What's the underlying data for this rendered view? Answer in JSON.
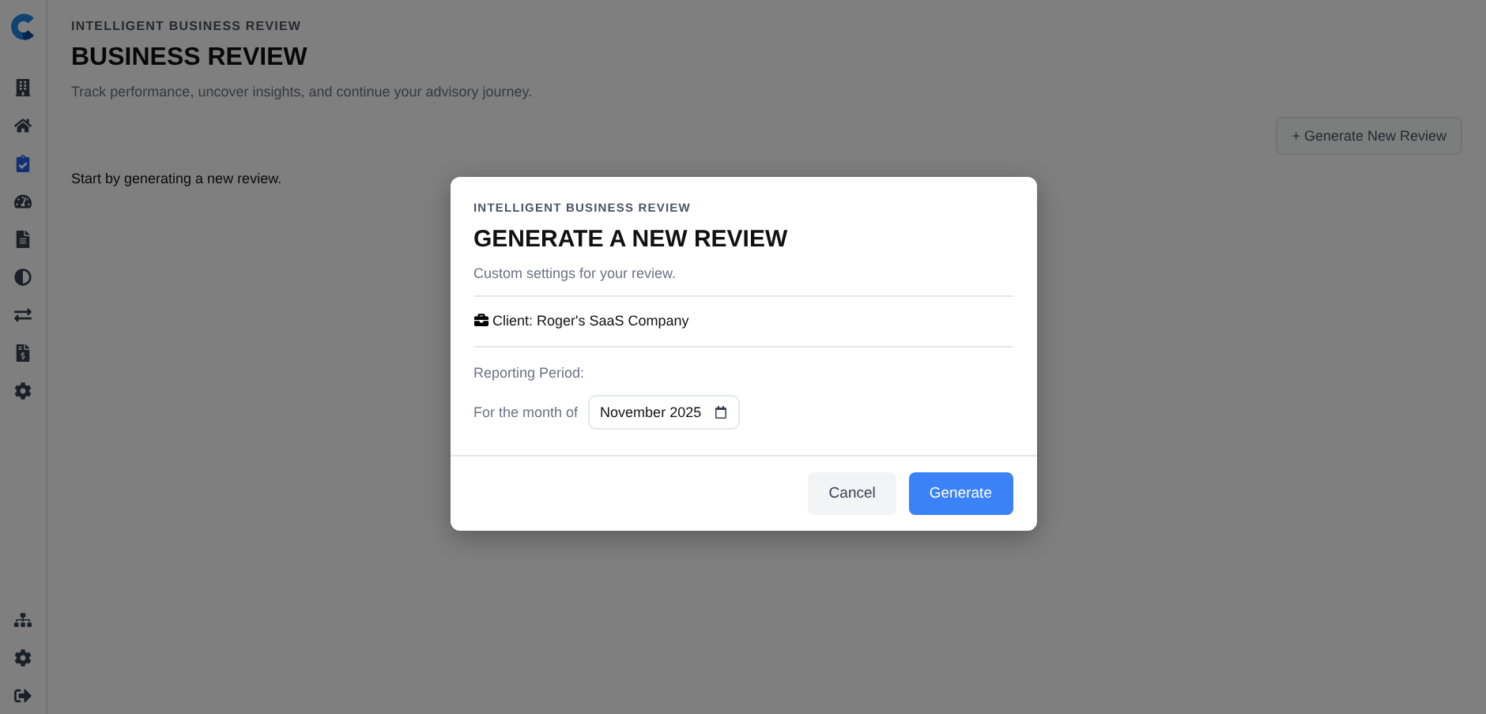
{
  "sidebar": {
    "items": [
      {
        "selected": false
      },
      {
        "selected": false
      },
      {
        "selected": true
      },
      {
        "selected": false
      },
      {
        "selected": false
      },
      {
        "selected": false
      },
      {
        "selected": false
      },
      {
        "selected": false
      },
      {
        "selected": false
      }
    ],
    "bottom_items": [
      {
        "selected": false
      },
      {
        "selected": false
      },
      {
        "selected": false
      }
    ]
  },
  "header": {
    "eyebrow": "INTELLIGENT BUSINESS REVIEW",
    "title": "BUSINESS REVIEW",
    "subtitle": "Track performance, uncover insights, and continue your advisory journey."
  },
  "new_review_button": "+ Generate New Review",
  "empty_message": "Start by generating a new review.",
  "dialog": {
    "eyebrow": "INTELLIGENT BUSINESS REVIEW",
    "title": "GENERATE A NEW REVIEW",
    "subtitle": "Custom settings for your review.",
    "client": "Client: Roger's SaaS Company",
    "period_label": "Reporting Period:",
    "month_label": "For the month of",
    "month_value": "November 2025",
    "buttons": [
      {
        "label": "Cancel",
        "kind": "secondary"
      },
      {
        "label": "Generate",
        "kind": "primary"
      }
    ]
  }
}
